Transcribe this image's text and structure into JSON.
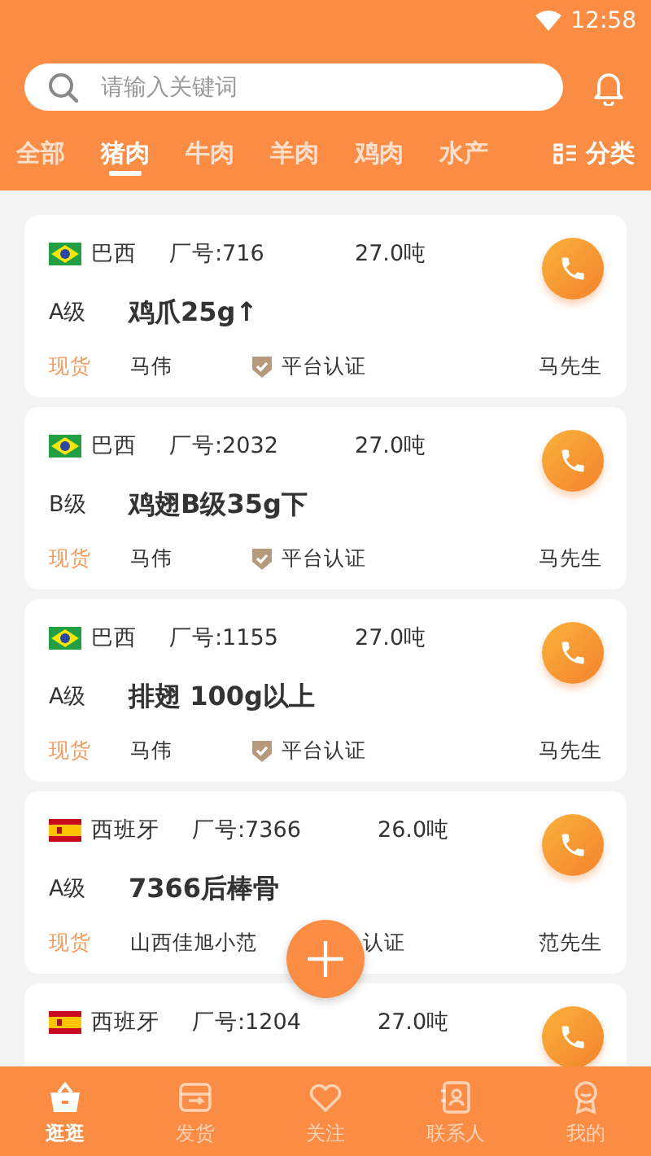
{
  "status_bar": {
    "time": "12:58"
  },
  "search": {
    "placeholder": "请输入关键词"
  },
  "tabs": [
    {
      "label": "全部",
      "selected": false
    },
    {
      "label": "猪肉",
      "selected": true
    },
    {
      "label": "牛肉",
      "selected": false
    },
    {
      "label": "羊肉",
      "selected": false
    },
    {
      "label": "鸡肉",
      "selected": false
    },
    {
      "label": "水产",
      "selected": false
    }
  ],
  "category_button": {
    "label": "分类"
  },
  "listings": [
    {
      "kind": "brazil",
      "country": "巴西",
      "factory": "厂号:716",
      "weight": "27.0吨",
      "grade": "A级",
      "product": "鸡爪25g↑",
      "stock": "现货",
      "seller": "马伟",
      "certification": {
        "text": "平台认证",
        "badge": true
      },
      "contact": "马先生"
    },
    {
      "kind": "brazil",
      "country": "巴西",
      "factory": "厂号:2032",
      "weight": "27.0吨",
      "grade": "B级",
      "product": "鸡翅B级35g下",
      "stock": "现货",
      "seller": "马伟",
      "certification": {
        "text": "平台认证",
        "badge": true
      },
      "contact": "马先生"
    },
    {
      "kind": "brazil",
      "country": "巴西",
      "factory": "厂号:1155",
      "weight": "27.0吨",
      "grade": "A级",
      "product": "排翅 100g以上",
      "stock": "现货",
      "seller": "马伟",
      "certification": {
        "text": "平台认证",
        "badge": true
      },
      "contact": "马先生"
    },
    {
      "kind": "spain",
      "country": "西班牙",
      "factory": "厂号:7366",
      "weight": "26.0吨",
      "grade": "A级",
      "product": "7366后棒骨",
      "stock": "现货",
      "seller": "山西佳旭小范",
      "certification": {
        "text": "认证",
        "badge": false
      },
      "contact": "范先生"
    },
    {
      "kind": "spain",
      "country": "西班牙",
      "factory": "厂号:1204",
      "weight": "27.0吨"
    }
  ],
  "bottom_nav": [
    {
      "label": "逛逛",
      "selected": true
    },
    {
      "label": "发货",
      "selected": false
    },
    {
      "label": "关注",
      "selected": false
    },
    {
      "label": "联系人",
      "selected": false
    },
    {
      "label": "我的",
      "selected": false
    }
  ]
}
